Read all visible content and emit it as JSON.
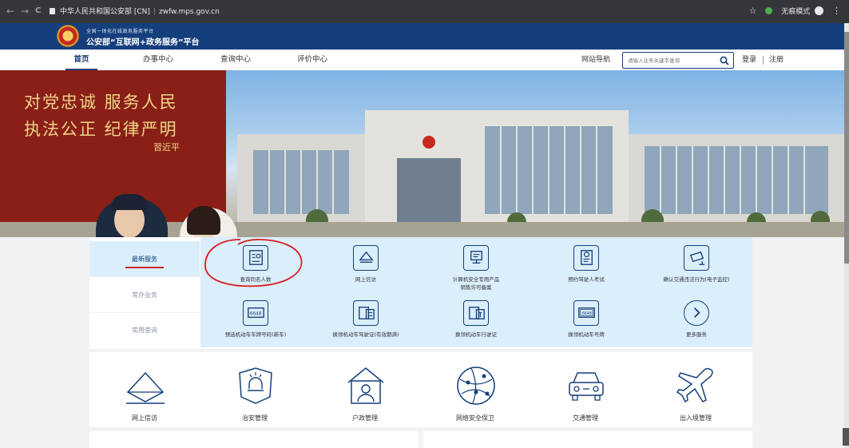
{
  "browser": {
    "back_glyph": "←",
    "forward_glyph": "→",
    "reload_glyph": "C",
    "site_owner": "中华人民共和国公安部 [CN]",
    "separator": "|",
    "url": "zwfw.mps.gov.cn",
    "star_glyph": "☆",
    "incognito_label": "无痕模式",
    "menu_glyph": "⋮"
  },
  "header": {
    "small_text": "全国一体化在线政务服务平台",
    "title": "公安部“互联网+政务服务”平台"
  },
  "nav": {
    "items": [
      "首页",
      "办事中心",
      "查询中心",
      "评价中心"
    ],
    "site_map": "网站导航",
    "search_placeholder": "请输入业务关键字查询",
    "login": "登录",
    "register": "注册"
  },
  "banner": {
    "line1": "对党忠诚 服务人民",
    "line2": "执法公正 纪律严明",
    "signature": "習近平"
  },
  "services": {
    "tabs": [
      "最新服务",
      "常办业务",
      "常用查询"
    ],
    "items": [
      {
        "label": "查询同名人数",
        "icon": "id-search-icon"
      },
      {
        "label": "网上信访",
        "icon": "envelope-icon"
      },
      {
        "label": "计算机安全专用产品\n销售许可备案",
        "icon": "computer-icon"
      },
      {
        "label": "预约驾驶人考试",
        "icon": "driver-exam-icon"
      },
      {
        "label": "确认交通违法行为(电子监控)",
        "icon": "camera-icon"
      },
      {
        "label": "预选机动车车牌号码(新车)",
        "icon": "plate-select-icon"
      },
      {
        "label": "换领机动车驾驶证(有效期满)",
        "icon": "license-renew-icon"
      },
      {
        "label": "换领机动车行驶证",
        "icon": "vehicle-license-icon"
      },
      {
        "label": "换领机动车号牌",
        "icon": "plate-renew-icon"
      },
      {
        "label": "更多服务",
        "icon": "more-icon"
      }
    ],
    "plate_text": "6648"
  },
  "categories": [
    {
      "label": "网上信访",
      "icon": "mail-icon"
    },
    {
      "label": "治安管理",
      "icon": "police-shield-icon"
    },
    {
      "label": "户政管理",
      "icon": "household-icon"
    },
    {
      "label": "网络安全保卫",
      "icon": "network-icon"
    },
    {
      "label": "交通管理",
      "icon": "car-icon"
    },
    {
      "label": "出入境管理",
      "icon": "airplane-icon"
    }
  ],
  "colors": {
    "brand": "#153f7c",
    "accent_red": "#c8281e",
    "service_bg": "#dbeefb"
  }
}
